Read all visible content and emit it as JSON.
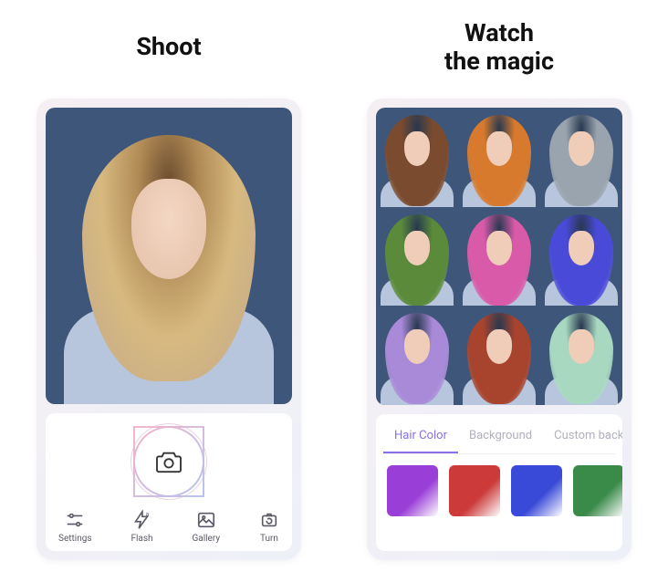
{
  "left": {
    "title": "Shoot",
    "toolbar": {
      "settings": "Settings",
      "flash": "Flash",
      "gallery": "Gallery",
      "turn": "Turn"
    }
  },
  "right": {
    "title": "Watch\nthe magic",
    "tabs": {
      "hair": "Hair Color",
      "background": "Background",
      "custom": "Custom back"
    },
    "hair_variants": [
      "#7a4b2e",
      "#d77a2e",
      "#9aa4ae",
      "#5a8a3a",
      "#d85aa8",
      "#4a4ad8",
      "#a98ad8",
      "#a8432e",
      "#a8d8c0"
    ],
    "swatches": [
      "#9a3ed8",
      "#cc3a3a",
      "#3a4ad8",
      "#3a8a4a"
    ]
  }
}
